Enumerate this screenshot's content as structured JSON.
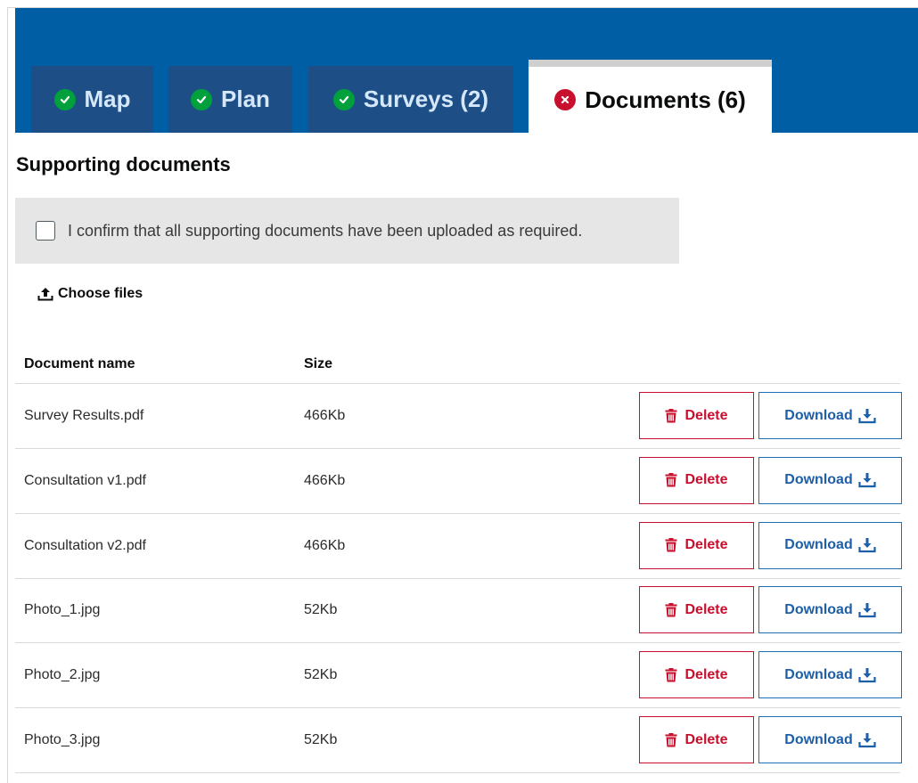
{
  "tabs": [
    {
      "label": "Map",
      "status": "complete",
      "icon": "check-circle-icon"
    },
    {
      "label": "Plan",
      "status": "complete",
      "icon": "check-circle-icon"
    },
    {
      "label": "Surveys (2)",
      "status": "complete",
      "icon": "check-circle-icon"
    },
    {
      "label": "Documents (6)",
      "status": "error",
      "icon": "error-circle-icon",
      "active": true
    }
  ],
  "section": {
    "title": "Supporting documents",
    "confirm_label": "I confirm that all supporting documents have been uploaded as required.",
    "confirm_checked": false,
    "choose_files_label": "Choose files"
  },
  "table": {
    "headers": {
      "name": "Document name",
      "size": "Size"
    },
    "delete_label": "Delete",
    "download_label": "Download",
    "rows": [
      {
        "name": "Survey Results.pdf",
        "size": "466Kb"
      },
      {
        "name": "Consultation v1.pdf",
        "size": "466Kb"
      },
      {
        "name": "Consultation v2.pdf",
        "size": "466Kb"
      },
      {
        "name": "Photo_1.jpg",
        "size": "52Kb"
      },
      {
        "name": "Photo_2.jpg",
        "size": "52Kb"
      },
      {
        "name": "Photo_3.jpg",
        "size": "52Kb"
      }
    ]
  },
  "colors": {
    "header_blue": "#005ea5",
    "tab_dark": "#1d4e86",
    "success_green": "#00a03c",
    "error_red": "#c8102e",
    "link_blue": "#1d70b8"
  }
}
